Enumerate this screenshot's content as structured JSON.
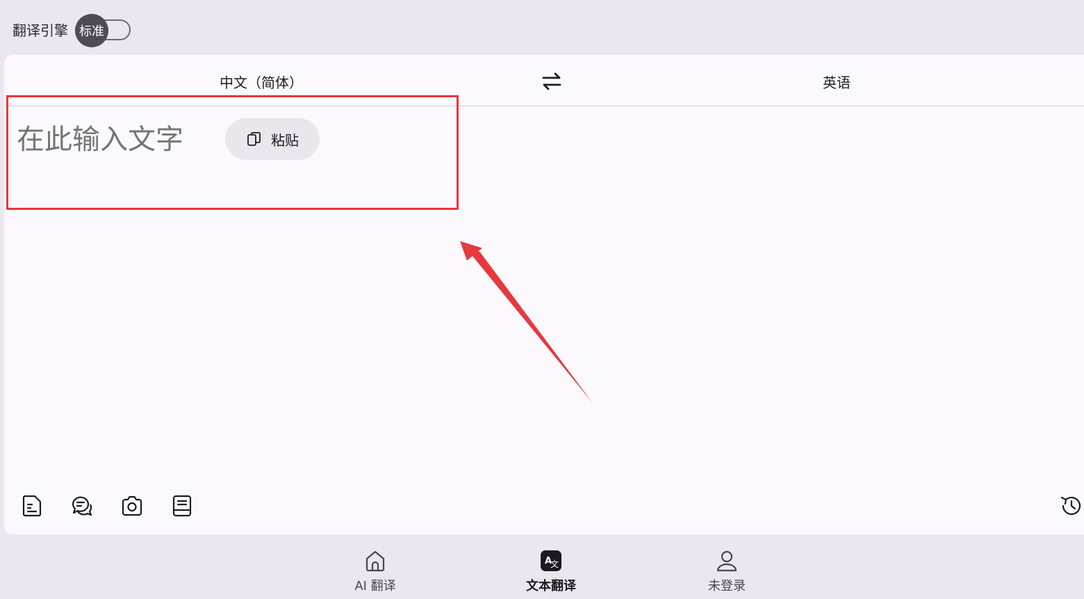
{
  "top": {
    "engine_label": "翻译引擎",
    "engine_toggle_text": "标准"
  },
  "languages": {
    "source": "中文（简体）",
    "target": "英语"
  },
  "input": {
    "placeholder": "在此输入文字",
    "paste_label": "粘贴"
  },
  "toolbar": {
    "icons": [
      "document-icon",
      "chat-bubbles-icon",
      "camera-icon",
      "book-icon",
      "history-icon"
    ]
  },
  "nav": {
    "items": [
      {
        "label": "AI 翻译",
        "icon": "home-icon",
        "active": false
      },
      {
        "label": "文本翻译",
        "icon": "translate-icon",
        "active": true
      },
      {
        "label": "未登录",
        "icon": "user-icon",
        "active": false
      }
    ]
  },
  "colors": {
    "accent_highlight": "#e5393e",
    "card_background": "#fcf9fe",
    "page_background": "#ebe6f0"
  }
}
